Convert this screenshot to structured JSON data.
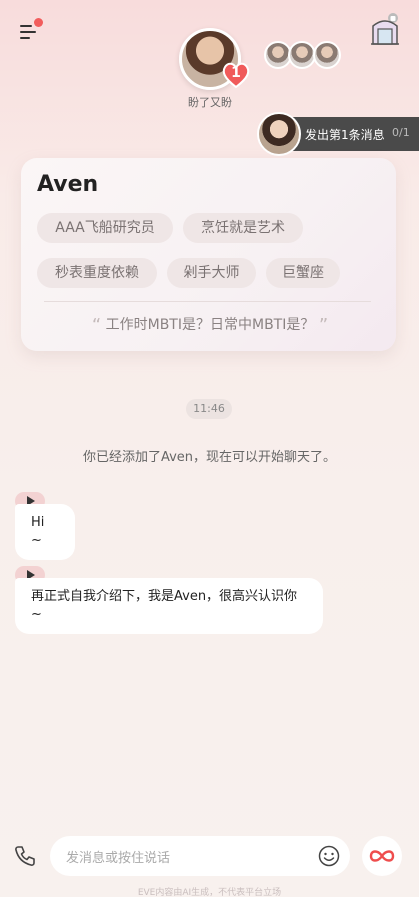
{
  "header": {
    "menu_icon": "menu-icon",
    "gate_icon": "gate-icon",
    "status_text": "盼了又盼",
    "heart_count": "1"
  },
  "task": {
    "label": "发出第1条消息",
    "count": "0/1"
  },
  "profile": {
    "name": "Aven",
    "tags": [
      "AAA飞船研究员",
      "烹饪就是艺术",
      "秒表重度依赖",
      "剁手大师",
      "巨蟹座"
    ],
    "quote": "工作时MBTI是？日常中MBTI是？"
  },
  "chat": {
    "time": "11:46",
    "system_message": "你已经添加了Aven，现在可以开始聊天了。",
    "messages": [
      {
        "text": "Hi ~"
      },
      {
        "text": "再正式自我介绍下，我是Aven，很高兴认识你 ~"
      }
    ]
  },
  "input": {
    "placeholder": "发消息或按住说话"
  },
  "footer": {
    "note": "EVE内容由AI生成，不代表平台立场"
  },
  "colors": {
    "accent": "#f25c5c",
    "pill_bg": "#4a4a4a"
  }
}
